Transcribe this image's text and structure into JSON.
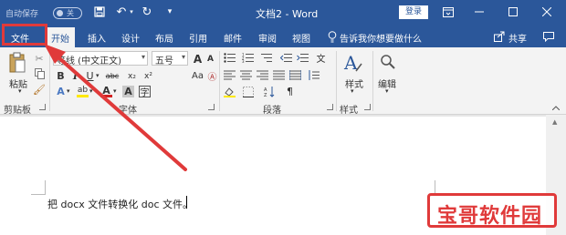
{
  "titlebar": {
    "autosave_label": "自动保存",
    "autosave_state": "关",
    "doc_title": "文档2",
    "separator": "-",
    "app_name": "Word",
    "login_button": "登录"
  },
  "tabs": [
    {
      "label": "文件"
    },
    {
      "label": "开始"
    },
    {
      "label": "插入"
    },
    {
      "label": "设计"
    },
    {
      "label": "布局"
    },
    {
      "label": "引用"
    },
    {
      "label": "邮件"
    },
    {
      "label": "审阅"
    },
    {
      "label": "视图"
    }
  ],
  "tell_me": "告诉我你想要做什么",
  "share": "共享",
  "ribbon": {
    "paste_label": "粘贴",
    "font_name": "等线 (中文正文)",
    "font_size": "五号",
    "font_size_grow": "A",
    "font_size_shrink": "A",
    "change_case": "Aa",
    "bold": "B",
    "italic": "I",
    "underline": "U",
    "strikethrough": "abc",
    "subscript": "x₂",
    "superscript": "x²",
    "text_effects": "A",
    "highlight": "ab",
    "font_color": "A",
    "char_shading": "A",
    "styles_label": "样式",
    "editing_label": "编辑",
    "groups": {
      "clipboard": "剪贴板",
      "font": "字体",
      "paragraph": "段落",
      "styles": "样式"
    }
  },
  "document": {
    "text": "把 docx 文件转换化 doc 文件。"
  },
  "watermark": "宝哥软件园",
  "colors": {
    "brand_blue": "#2b579a",
    "annotation_red": "#e03a3a",
    "font_color_red": "#d32020",
    "highlight_yellow": "#ffe900"
  }
}
